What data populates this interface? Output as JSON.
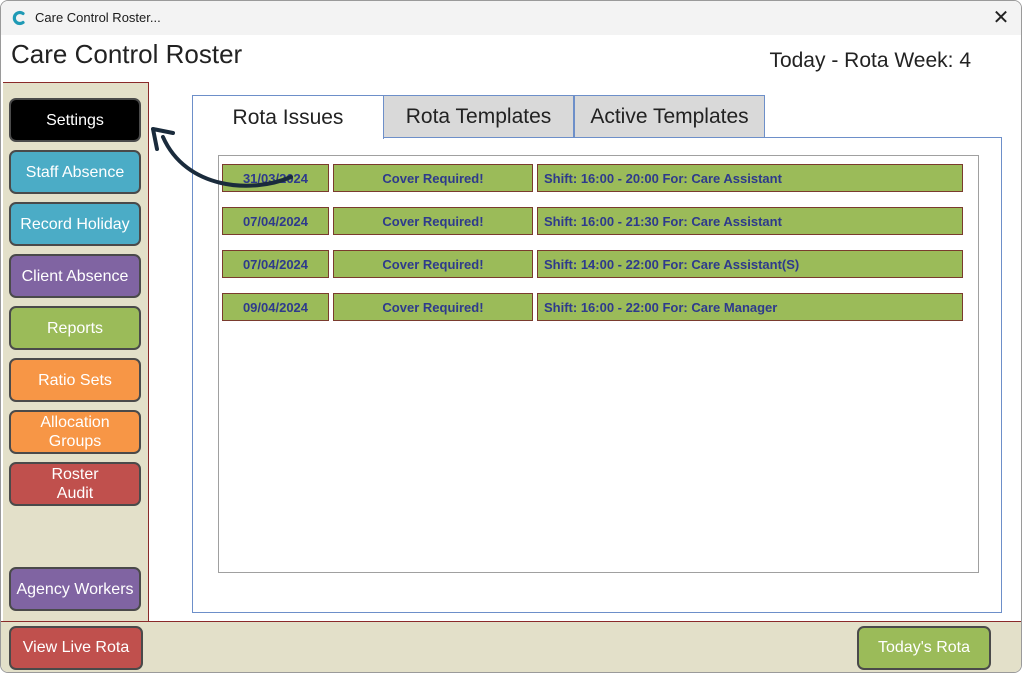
{
  "window": {
    "title": "Care Control Roster..."
  },
  "header": {
    "app_title": "Care Control Roster",
    "week_label": "Today - Rota Week: 4"
  },
  "sidebar": {
    "items": [
      {
        "label": "Settings",
        "color": "#000000"
      },
      {
        "label": "Staff Absence",
        "color": "#4bacc6"
      },
      {
        "label": "Record Holiday",
        "color": "#4bacc6"
      },
      {
        "label": "Client Absence",
        "color": "#8064a2"
      },
      {
        "label": "Reports",
        "color": "#9bbb59"
      },
      {
        "label": "Ratio Sets",
        "color": "#f79646"
      },
      {
        "label": "Allocation\nGroups",
        "color": "#f79646"
      },
      {
        "label": "Roster\nAudit",
        "color": "#c0504d"
      },
      {
        "label": "Agency Workers",
        "color": "#8064a2"
      }
    ]
  },
  "tabs": [
    {
      "label": "Rota Issues",
      "active": true
    },
    {
      "label": "Rota Templates",
      "active": false
    },
    {
      "label": "Active Templates",
      "active": false
    }
  ],
  "issues": [
    {
      "date": "31/03/2024",
      "status": "Cover Required!",
      "detail": "Shift: 16:00 - 20:00 For: Care Assistant"
    },
    {
      "date": "07/04/2024",
      "status": "Cover Required!",
      "detail": "Shift: 16:00 - 21:30 For: Care Assistant"
    },
    {
      "date": "07/04/2024",
      "status": "Cover Required!",
      "detail": "Shift: 14:00 - 22:00 For: Care Assistant(S)"
    },
    {
      "date": "09/04/2024",
      "status": "Cover Required!",
      "detail": "Shift: 16:00 - 22:00 For: Care Manager"
    }
  ],
  "footer": {
    "view_live_rota": "View Live Rota",
    "todays_rota": "Today's Rota",
    "view_color": "#c0504d",
    "today_color": "#9bbb59"
  },
  "icons": {
    "app": "app-logo-icon",
    "close": "close-icon",
    "arrow": "curved-arrow-icon"
  }
}
